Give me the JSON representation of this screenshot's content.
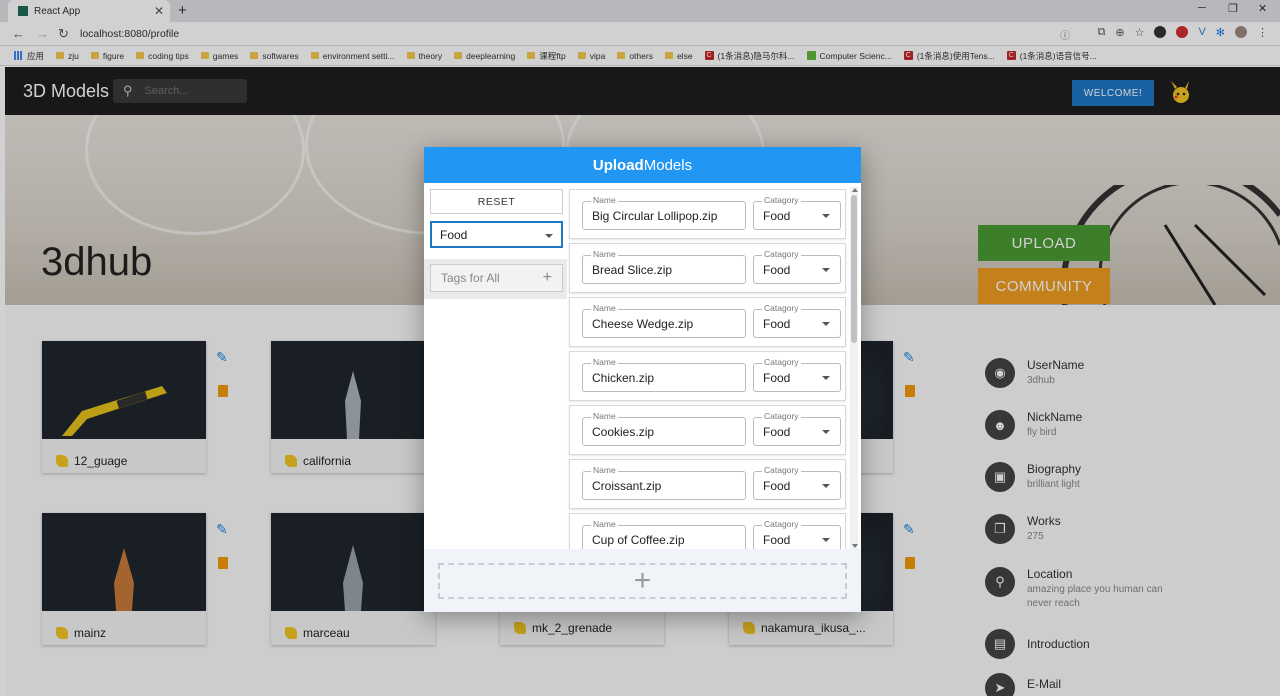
{
  "browser": {
    "tab_title": "React App",
    "url": "localhost:8080/profile",
    "bookmarks": [
      "应用",
      "zju",
      "figure",
      "coding tips",
      "games",
      "softwares",
      "environment setti...",
      "theory",
      "deeplearning",
      "课程ftp",
      "vipa",
      "others",
      "else",
      "(1条消息)隐马尔科...",
      "Computer Scienc...",
      "(1条消息)使用Tens...",
      "(1条消息)语音信号..."
    ]
  },
  "app": {
    "title": "3D Models",
    "search_placeholder": "Search...",
    "welcome_label": "WELCOME!",
    "hero_title": "3dhub",
    "upload_label": "UPLOAD",
    "community_label": "COMMUNITY"
  },
  "models": [
    {
      "name": "12_guage"
    },
    {
      "name": "california"
    },
    {
      "name": "mainz"
    },
    {
      "name": "marceau"
    },
    {
      "name": "mk_2_grenade"
    },
    {
      "name": "nakamura_ikusa_..."
    }
  ],
  "profile": [
    {
      "label": "UserName",
      "value": "3dhub",
      "icon": "fingerprint-icon"
    },
    {
      "label": "NickName",
      "value": "fly bird",
      "icon": "reddit-icon"
    },
    {
      "label": "Biography",
      "value": "brilliant light",
      "icon": "contact-card-icon"
    },
    {
      "label": "Works",
      "value": "275",
      "icon": "copy-icon"
    },
    {
      "label": "Location",
      "value": "amazing place you human can never reach",
      "icon": "location-pin-icon"
    },
    {
      "label": "Introduction",
      "value": "",
      "icon": "book-icon"
    },
    {
      "label": "E-Mail",
      "value": "",
      "icon": "send-icon"
    }
  ],
  "modal": {
    "title_bold": "Upload",
    "title_rest": "Models",
    "reset_label": "RESET",
    "category_value": "Food",
    "tags_placeholder": "Tags for All",
    "name_label": "Name",
    "category_label": "Catagory",
    "files": [
      {
        "name": "Big Circular Lollipop.zip",
        "category": "Food"
      },
      {
        "name": "Bread Slice.zip",
        "category": "Food"
      },
      {
        "name": "Cheese Wedge.zip",
        "category": "Food"
      },
      {
        "name": "Chicken.zip",
        "category": "Food"
      },
      {
        "name": "Cookies.zip",
        "category": "Food"
      },
      {
        "name": "Croissant.zip",
        "category": "Food"
      },
      {
        "name": "Cup of Coffee.zip",
        "category": "Food"
      }
    ],
    "add_symbol": "+"
  },
  "colors": {
    "primary": "#2196f3",
    "upload": "#4a9a32",
    "community": "#f09d20",
    "welcome": "#1e78c8"
  }
}
